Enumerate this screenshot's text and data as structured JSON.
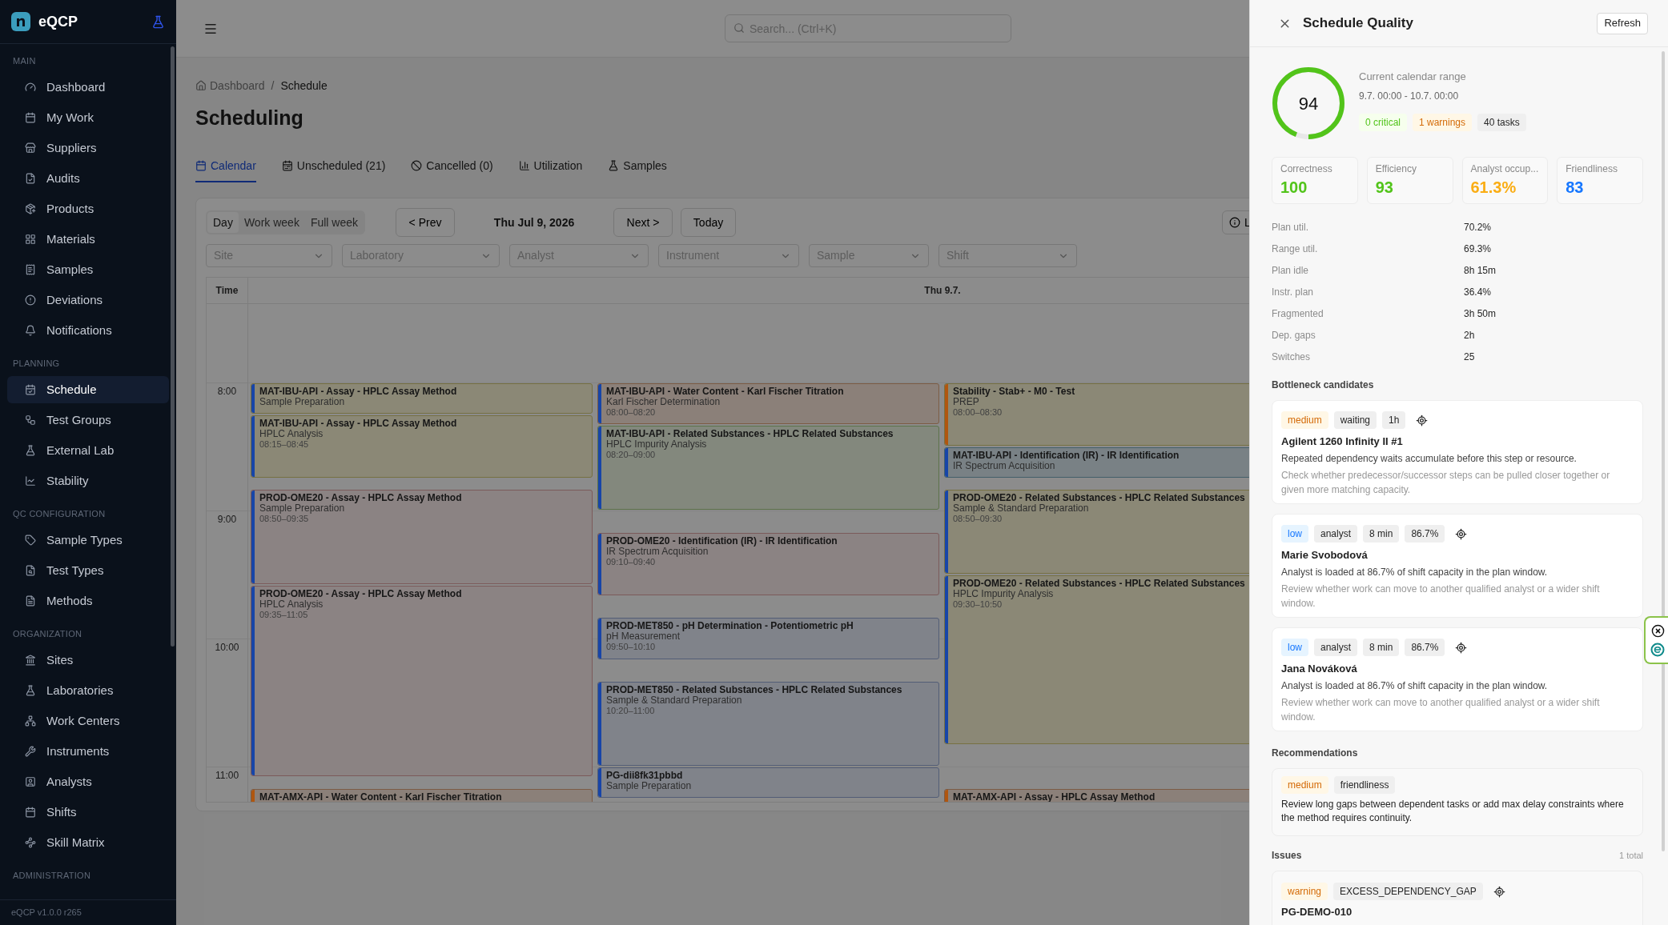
{
  "sidebar": {
    "brand": "eQCP",
    "sections": [
      {
        "label": "MAIN",
        "items": [
          {
            "label": "Dashboard",
            "selected": false
          },
          {
            "label": "My Work",
            "selected": false
          },
          {
            "label": "Suppliers",
            "selected": false
          },
          {
            "label": "Audits",
            "selected": false
          },
          {
            "label": "Products",
            "selected": false
          },
          {
            "label": "Materials",
            "selected": false
          },
          {
            "label": "Samples",
            "selected": false
          },
          {
            "label": "Deviations",
            "selected": false
          },
          {
            "label": "Notifications",
            "selected": false
          }
        ]
      },
      {
        "label": "PLANNING",
        "items": [
          {
            "label": "Schedule",
            "selected": true
          },
          {
            "label": "Test Groups",
            "selected": false
          },
          {
            "label": "External Lab",
            "selected": false
          },
          {
            "label": "Stability",
            "selected": false
          }
        ]
      },
      {
        "label": "QC CONFIGURATION",
        "items": [
          {
            "label": "Sample Types",
            "selected": false
          },
          {
            "label": "Test Types",
            "selected": false
          },
          {
            "label": "Methods",
            "selected": false
          }
        ]
      },
      {
        "label": "ORGANIZATION",
        "items": [
          {
            "label": "Sites",
            "selected": false
          },
          {
            "label": "Laboratories",
            "selected": false
          },
          {
            "label": "Work Centers",
            "selected": false
          },
          {
            "label": "Instruments",
            "selected": false
          },
          {
            "label": "Analysts",
            "selected": false
          },
          {
            "label": "Shifts",
            "selected": false
          },
          {
            "label": "Skill Matrix",
            "selected": false
          }
        ]
      },
      {
        "label": "ADMINISTRATION"
      }
    ],
    "footer": "eQCP v1.0.0 r265"
  },
  "topbar": {
    "search": {
      "placeholder": "Search... (Ctrl+K)"
    }
  },
  "breadcrumb": {
    "items": [
      "Dashboard",
      "Schedule"
    ],
    "separator": "/"
  },
  "title": "Scheduling",
  "tabs": [
    {
      "label": "Calendar",
      "selected": true
    },
    {
      "label": "Unscheduled (21)",
      "selected": false
    },
    {
      "label": "Cancelled (0)",
      "selected": false
    },
    {
      "label": "Utilization",
      "selected": false
    },
    {
      "label": "Samples",
      "selected": false
    }
  ],
  "calendar": {
    "views": [
      {
        "label": "Day",
        "selected": true
      },
      {
        "label": "Work week",
        "selected": false
      },
      {
        "label": "Full week",
        "selected": false
      }
    ],
    "prev": "< Prev",
    "date": "Thu Jul 9, 2026",
    "next": "Next >",
    "today": "Today",
    "cut_button": "L",
    "filters": [
      {
        "placeholder": "Site"
      },
      {
        "placeholder": "Laboratory"
      },
      {
        "placeholder": "Analyst"
      },
      {
        "placeholder": "Instrument"
      },
      {
        "placeholder": "Sample"
      },
      {
        "placeholder": "Shift"
      }
    ],
    "time_header": "Time",
    "day_header": "Thu 9.7.",
    "hours": [
      "8:00",
      "9:00",
      "10:00",
      "11:00"
    ],
    "columns": [
      [
        {
          "title": "MAT-IBU-API - Assay - HPLC Assay Method",
          "subtitle": "Sample Preparation",
          "color": "#1745a8",
          "kind": "amber"
        },
        {
          "title": "MAT-IBU-API - Assay - HPLC Assay Method",
          "subtitle": "HPLC Analysis",
          "time": "08:15–08:45",
          "color": "#1745a8",
          "kind": "amber"
        },
        {
          "title": "PROD-OME20 - Assay - HPLC Assay Method",
          "subtitle": "Sample Preparation",
          "time": "08:50–09:35",
          "color": "#1745a8",
          "kind": "rose"
        },
        {
          "title": "PROD-OME20 - Assay - HPLC Assay Method",
          "subtitle": "HPLC Analysis",
          "time": "09:35–11:05",
          "color": "#1745a8",
          "kind": "rose"
        },
        {
          "title": "MAT-AMX-API - Water Content - Karl Fischer Titration",
          "color": "#b0560f",
          "kind": "peach"
        }
      ],
      [
        {
          "title": "MAT-IBU-API - Water Content - Karl Fischer Titration",
          "subtitle": "Karl Fischer Determination",
          "time": "08:00–08:20",
          "color": "#1745a8",
          "kind": "peach"
        },
        {
          "title": "MAT-IBU-API - Related Substances - HPLC Related Substances",
          "subtitle": "HPLC Impurity Analysis",
          "time": "08:20–09:00",
          "color": "#1745a8",
          "kind": "mint"
        },
        {
          "title": "PROD-OME20 - Identification (IR) - IR Identification",
          "subtitle": "IR Spectrum Acquisition",
          "time": "09:10–09:40",
          "color": "#1745a8",
          "kind": "rose"
        },
        {
          "title": "PROD-MET850 - pH Determination - Potentiometric pH",
          "subtitle": "pH Measurement",
          "time": "09:50–10:10",
          "color": "#1745a8",
          "kind": "sky"
        },
        {
          "title": "PROD-MET850 - Related Substances - HPLC Related Substances",
          "subtitle": "Sample & Standard Preparation",
          "time": "10:20–11:00",
          "color": "#1745a8",
          "kind": "sky"
        },
        {
          "title": "PG-dii8fk31pbbd",
          "subtitle": "Sample Preparation",
          "color": "#1745a8",
          "kind": "sky"
        }
      ],
      [
        {
          "title": "Stability - Stab+ - M0 - Test",
          "subtitle": "PREP",
          "time": "08:00–08:30",
          "color": "#b0560f",
          "kind": "amber"
        },
        {
          "title": "MAT-IBU-API - Identification (IR) - IR Identification",
          "subtitle": "IR Spectrum Acquisition",
          "color": "#1745a8",
          "kind": "teal"
        },
        {
          "title": "PROD-OME20 - Related Substances - HPLC Related Substances",
          "subtitle": "Sample & Standard Preparation",
          "time": "08:50–09:30",
          "color": "#1745a8",
          "kind": "amber"
        },
        {
          "title": "PROD-OME20 - Related Substances - HPLC Related Substances",
          "subtitle": "HPLC Impurity Analysis",
          "time": "09:30–10:50",
          "color": "#1745a8",
          "kind": "amber"
        },
        {
          "title": "MAT-AMX-API - Assay - HPLC Assay Method",
          "color": "#b0560f",
          "kind": "peach"
        }
      ]
    ]
  },
  "quality": {
    "title": "Schedule Quality",
    "refresh": "Refresh",
    "score": {
      "value": "94",
      "level": 0.94
    },
    "range_label": "Current calendar range",
    "range": "9.7. 00:00 - 10.7. 00:00",
    "badges": [
      {
        "text": "0 critical",
        "kind": "success"
      },
      {
        "text": "1 warnings",
        "kind": "warning"
      },
      {
        "text": "40 tasks",
        "kind": "neutral"
      }
    ],
    "metrics": [
      {
        "label": "Correctness",
        "value": "100",
        "color": "#52c41a"
      },
      {
        "label": "Efficiency",
        "value": "93",
        "color": "#52c41a"
      },
      {
        "label": "Analyst occup...",
        "value": "61.3%",
        "color": "#faad14"
      },
      {
        "label": "Friendliness",
        "value": "83",
        "color": "#1677ff"
      }
    ],
    "stats": [
      {
        "label": "Plan util.",
        "value": "70.2%"
      },
      {
        "label": "Range util.",
        "value": "69.3%"
      },
      {
        "label": "Plan idle",
        "value": "8h 15m"
      },
      {
        "label": "Instr. plan",
        "value": "36.4%"
      },
      {
        "label": "Fragmented",
        "value": "3h 50m"
      },
      {
        "label": "Dep. gaps",
        "value": "2h"
      },
      {
        "label": "Switches",
        "value": "25"
      }
    ],
    "bottlenecks": {
      "title": "Bottleneck candidates",
      "items": [
        {
          "tags": [
            {
              "text": "medium",
              "kind": "medium"
            },
            {
              "text": "waiting",
              "kind": "neutral"
            },
            {
              "text": "1h",
              "kind": "neutral"
            }
          ],
          "locate": true,
          "name": "Agilent 1260 Infinity II #1",
          "description": "Repeated dependency waits accumulate before this step or resource.",
          "hint": "Check whether predecessor/successor steps can be pulled closer together or given more matching capacity."
        },
        {
          "tags": [
            {
              "text": "low",
              "kind": "low"
            },
            {
              "text": "analyst",
              "kind": "neutral"
            },
            {
              "text": "8 min",
              "kind": "neutral"
            },
            {
              "text": "86.7%",
              "kind": "neutral"
            }
          ],
          "locate": true,
          "name": "Marie Svobodová",
          "description": "Analyst is loaded at 86.7% of shift capacity in the plan window.",
          "hint": "Review whether work can move to another qualified analyst or a wider shift window."
        },
        {
          "tags": [
            {
              "text": "low",
              "kind": "low"
            },
            {
              "text": "analyst",
              "kind": "neutral"
            },
            {
              "text": "8 min",
              "kind": "neutral"
            },
            {
              "text": "86.7%",
              "kind": "neutral"
            }
          ],
          "locate": true,
          "name": "Jana Nováková",
          "description": "Analyst is loaded at 86.7% of shift capacity in the plan window.",
          "hint": "Review whether work can move to another qualified analyst or a wider shift window."
        }
      ]
    },
    "recommendations": {
      "title": "Recommendations",
      "items": [
        {
          "tags": [
            {
              "text": "medium",
              "kind": "medium"
            },
            {
              "text": "friendliness",
              "kind": "neutral"
            }
          ],
          "text": "Review long gaps between dependent tasks or add max delay constraints where the method requires continuity."
        }
      ]
    },
    "issues": {
      "title": "Issues",
      "count": "1 total",
      "items": [
        {
          "tags": [
            {
              "text": "warning",
              "kind": "warning"
            },
            {
              "text": "EXCESS_DEPENDENCY_GAP",
              "kind": "neutral"
            }
          ],
          "locate": true,
          "name": "PG-DEMO-010"
        }
      ]
    }
  }
}
